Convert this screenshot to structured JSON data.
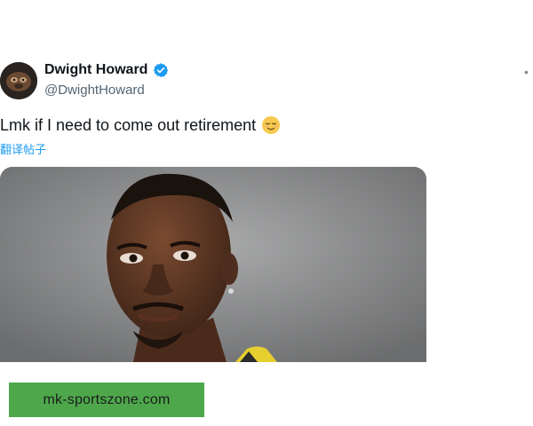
{
  "tweet": {
    "display_name": "Dwight Howard",
    "handle": "@DwightHoward",
    "text": "Lmk if I need to come out retirement",
    "emoji": "relieved-face-emoji",
    "translate_label": "翻译帖子",
    "verified_icon": "verified-badge-icon",
    "more_icon": "dot-icon"
  },
  "banner": {
    "text": "mk-sportszone.com"
  },
  "colors": {
    "verified": "#1d9bf0",
    "translate": "#1d9bf0",
    "banner_bg": "#4ea84b",
    "handle": "#536471"
  }
}
